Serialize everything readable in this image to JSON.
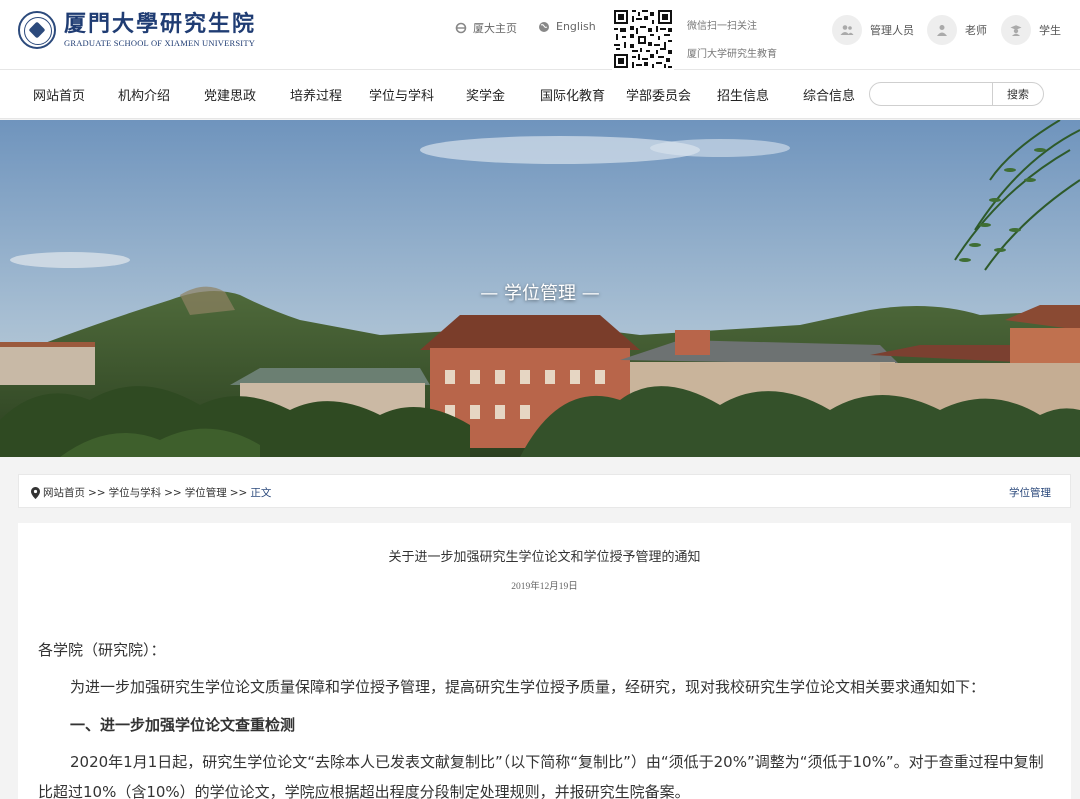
{
  "header": {
    "logo_cn": "厦門大學研究生院",
    "logo_en": "GRADUATE SCHOOL OF XIAMEN UNIVERSITY",
    "links": [
      {
        "label": "厦大主页",
        "icon": "ie-icon"
      },
      {
        "label": "English",
        "icon": "globe-icon"
      }
    ],
    "wechat_line1": "微信扫一扫关注",
    "wechat_line2": "厦门大学研究生教育",
    "roles": [
      {
        "label": "管理人员",
        "icon": "group-icon"
      },
      {
        "label": "老师",
        "icon": "user-icon"
      },
      {
        "label": "学生",
        "icon": "graduate-icon"
      }
    ]
  },
  "nav": {
    "items": [
      "网站首页",
      "机构介绍",
      "党建思政",
      "培养过程",
      "学位与学科",
      "奖学金",
      "国际化教育",
      "学部委员会",
      "招生信息",
      "综合信息"
    ],
    "search_placeholder": "",
    "search_label": "搜索"
  },
  "banner": {
    "title": "— 学位管理 —"
  },
  "breadcrumb": {
    "items": [
      "网站首页",
      "学位与学科",
      "学位管理",
      "正文"
    ],
    "separator": ">>",
    "section": "学位管理"
  },
  "article": {
    "title": "关于进一步加强研究生学位论文和学位授予管理的通知",
    "date": "2019年12月19日",
    "salutation": "各学院（研究院）：",
    "intro": "为进一步加强研究生学位论文质量保障和学位授予管理，提高研究生学位授予质量，经研究，现对我校研究生学位论文相关要求通知如下：",
    "heading1": "一、进一步加强学位论文查重检测",
    "para1_line1": "2020年1月1日起，研究生学位论文“去除本人已发表文献复制比”（以下简称“复制比”）由“须低于20%”调整为“须低于10%”。对于查重过程中复制",
    "para1_line2": "比超过10%（含10%）的学位论文，学院应根据超出程度分段制定处理规则，并报研究生院备案。"
  },
  "colors": {
    "brand": "#1f3c73",
    "link": "#2c4a7c"
  }
}
